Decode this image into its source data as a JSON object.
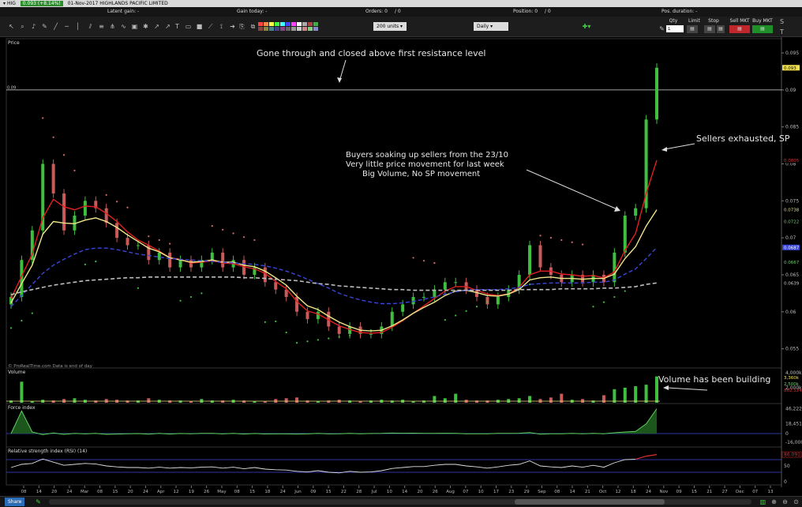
{
  "window": {
    "symbol": "HIG",
    "price_change": "0.093 (+8.14%)",
    "date_name": "01-Nov-2017 HIGHLANDS PACIFIC LIMITED"
  },
  "stats": {
    "latent_gain": "Latent gain: -",
    "gain_today": "Gain today: -",
    "orders": "Orders: 0",
    "orders_tail": "/ 0",
    "position": "Position: 0",
    "position_tail": "/ 0",
    "pos_duration": "Pos. duration: -"
  },
  "toolbar": {
    "units": "200 units",
    "timeframe": "Daily",
    "qty_label": "Qty",
    "qty_value": "1",
    "limit_label": "Limit",
    "stop_label": "Stop",
    "sell_label": "Sell MKT",
    "buy_label": "Buy MKT"
  },
  "panels": {
    "price_label": "Price",
    "volume_label": "Volume",
    "force_label": "Force index",
    "rsi_label": "Relative strength index (RSI) (14)"
  },
  "footer_note": "© ProRealTime.com  Data is end of day",
  "share_label": "Share",
  "colors": {
    "up": "#3fbf3f",
    "down": "#c85a5a",
    "ma_fast": "#e02020",
    "ma_mid": "#f0e68c",
    "ma_blue": "#3a46d8",
    "ma_long": "#bdbdbd",
    "sar_up": "#3fbf3f",
    "sar_down": "#d86a6a",
    "resistance": "#ffffff",
    "background": "#000000"
  },
  "chart_data": {
    "type": "line",
    "x_tick_labels": [
      "08",
      "14",
      "20",
      "24",
      "Mar",
      "08",
      "15",
      "20",
      "24",
      "Apr",
      "12",
      "19",
      "26",
      "May",
      "08",
      "15",
      "18",
      "24",
      "Jun",
      "09",
      "15",
      "22",
      "28",
      "Jul",
      "10",
      "14",
      "20",
      "26",
      "Aug",
      "07",
      "10",
      "17",
      "23",
      "29",
      "Sep",
      "08",
      "14",
      "21",
      "Oct",
      "12",
      "18",
      "24",
      "Nov",
      "09",
      "15",
      "21",
      "27",
      "Dec",
      "07",
      "13"
    ],
    "price_axis": {
      "ylim": [
        0.0525,
        0.0965
      ],
      "ticks": [
        "0.095",
        "0.09",
        "0.085",
        "0.08",
        "0.075",
        "0.07",
        "0.065",
        "0.06",
        "0.055"
      ],
      "markers": [
        {
          "label": "0.093",
          "value": 0.093,
          "color": "#f0e050",
          "text_color": "#000"
        },
        {
          "label": "0.0805",
          "value": 0.0805,
          "color": "#000",
          "text_color": "#e03030"
        },
        {
          "label": "0.0738",
          "value": 0.0738,
          "color": "#000",
          "text_color": "#e0e080"
        },
        {
          "label": "0.0722",
          "value": 0.0722,
          "color": "#000",
          "text_color": "#6fd06f"
        },
        {
          "label": "0.0687",
          "value": 0.0687,
          "color": "#3a46d8",
          "text_color": "#fff"
        },
        {
          "label": "0.0667",
          "value": 0.0667,
          "color": "#000",
          "text_color": "#6fd06f"
        },
        {
          "label": "0.0639",
          "value": 0.0639,
          "color": "#000",
          "text_color": "#ccc"
        }
      ],
      "resistance": {
        "value": 0.09,
        "label": "0.09"
      }
    },
    "close": [
      0.062,
      0.067,
      0.071,
      0.08,
      0.076,
      0.071,
      0.073,
      0.075,
      0.074,
      0.072,
      0.07,
      0.069,
      0.069,
      0.067,
      0.068,
      0.066,
      0.067,
      0.066,
      0.067,
      0.068,
      0.066,
      0.067,
      0.065,
      0.066,
      0.064,
      0.063,
      0.062,
      0.06,
      0.059,
      0.06,
      0.058,
      0.057,
      0.058,
      0.057,
      0.057,
      0.058,
      0.06,
      0.061,
      0.062,
      0.062,
      0.063,
      0.064,
      0.064,
      0.063,
      0.062,
      0.061,
      0.062,
      0.063,
      0.065,
      0.069,
      0.066,
      0.065,
      0.064,
      0.065,
      0.064,
      0.065,
      0.064,
      0.068,
      0.073,
      0.074,
      0.086,
      0.093
    ],
    "series": [
      {
        "name": "Simple moving average 7",
        "values": [
          0.0618,
          0.0648,
          0.0678,
          0.0727,
          0.0752,
          0.0742,
          0.0738,
          0.0743,
          0.0742,
          0.0733,
          0.0722,
          0.0708,
          0.0697,
          0.069,
          0.0682,
          0.0673,
          0.0671,
          0.0666,
          0.0667,
          0.0669,
          0.0666,
          0.0665,
          0.0661,
          0.0658,
          0.0652,
          0.0641,
          0.0631,
          0.0614,
          0.0601,
          0.0597,
          0.0589,
          0.0581,
          0.0576,
          0.0572,
          0.0571,
          0.0572,
          0.0579,
          0.0588,
          0.0598,
          0.0608,
          0.0618,
          0.0628,
          0.0634,
          0.0634,
          0.0629,
          0.0624,
          0.0622,
          0.0624,
          0.0633,
          0.065,
          0.0655,
          0.0655,
          0.0651,
          0.065,
          0.0648,
          0.0649,
          0.0646,
          0.0654,
          0.0683,
          0.0706,
          0.076,
          0.0805
        ]
      },
      {
        "name": "Simple moving average 20",
        "values": [
          0.0612,
          0.0638,
          0.0663,
          0.0705,
          0.0722,
          0.072,
          0.0719,
          0.0724,
          0.0727,
          0.0722,
          0.0714,
          0.0704,
          0.0695,
          0.0686,
          0.0681,
          0.0673,
          0.067,
          0.0667,
          0.0668,
          0.067,
          0.0667,
          0.0667,
          0.0663,
          0.0661,
          0.0655,
          0.0646,
          0.0636,
          0.0621,
          0.0608,
          0.0603,
          0.0594,
          0.0586,
          0.058,
          0.0575,
          0.0574,
          0.0575,
          0.0581,
          0.0589,
          0.0598,
          0.0606,
          0.0613,
          0.0622,
          0.0628,
          0.0629,
          0.0626,
          0.0622,
          0.0621,
          0.0624,
          0.063,
          0.0643,
          0.0646,
          0.0647,
          0.0645,
          0.0645,
          0.0644,
          0.0645,
          0.0645,
          0.0651,
          0.0672,
          0.0688,
          0.0716,
          0.0738
        ]
      },
      {
        "name": "Moving average 50",
        "values": [
          0.0607,
          0.0622,
          0.0637,
          0.0652,
          0.0663,
          0.0671,
          0.0678,
          0.0684,
          0.0686,
          0.0686,
          0.0684,
          0.0681,
          0.0678,
          0.0676,
          0.0674,
          0.0672,
          0.0671,
          0.067,
          0.0669,
          0.0668,
          0.0667,
          0.0666,
          0.0665,
          0.0664,
          0.0662,
          0.0659,
          0.0655,
          0.065,
          0.0644,
          0.0638,
          0.0632,
          0.0625,
          0.062,
          0.0616,
          0.0613,
          0.0611,
          0.0611,
          0.0612,
          0.0614,
          0.0617,
          0.062,
          0.0624,
          0.0627,
          0.0629,
          0.063,
          0.063,
          0.063,
          0.0631,
          0.0633,
          0.0637,
          0.0638,
          0.0639,
          0.0639,
          0.0639,
          0.0639,
          0.064,
          0.064,
          0.0643,
          0.0651,
          0.0658,
          0.0672,
          0.0687
        ]
      },
      {
        "name": "Moving average 200",
        "values": [
          0.0623,
          0.0627,
          0.063,
          0.0633,
          0.0636,
          0.0638,
          0.064,
          0.0642,
          0.0643,
          0.0644,
          0.0645,
          0.0646,
          0.0646,
          0.0647,
          0.0647,
          0.0647,
          0.0647,
          0.0647,
          0.0647,
          0.0647,
          0.0647,
          0.0647,
          0.0646,
          0.0646,
          0.0645,
          0.0644,
          0.0643,
          0.0642,
          0.064,
          0.0638,
          0.0637,
          0.0635,
          0.0634,
          0.0633,
          0.0632,
          0.0631,
          0.063,
          0.063,
          0.0629,
          0.0629,
          0.0629,
          0.0629,
          0.0629,
          0.0629,
          0.0629,
          0.0629,
          0.0629,
          0.0629,
          0.063,
          0.063,
          0.063,
          0.063,
          0.0631,
          0.0631,
          0.0631,
          0.0631,
          0.0632,
          0.0632,
          0.0633,
          0.0634,
          0.0637,
          0.0639
        ]
      }
    ],
    "sar_down": [
      [
        3,
        0.0862
      ],
      [
        4,
        0.0836
      ],
      [
        5,
        0.0812
      ],
      [
        6,
        0.0791
      ],
      [
        9,
        0.0758
      ],
      [
        10,
        0.0749
      ],
      [
        11,
        0.0741
      ],
      [
        13,
        0.0702
      ],
      [
        14,
        0.0697
      ],
      [
        15,
        0.0692
      ],
      [
        19,
        0.0716
      ],
      [
        20,
        0.0711
      ],
      [
        21,
        0.0706
      ],
      [
        22,
        0.0701
      ],
      [
        23,
        0.0697
      ],
      [
        38,
        0.0673
      ],
      [
        39,
        0.0669
      ],
      [
        40,
        0.0666
      ],
      [
        50,
        0.0703
      ],
      [
        51,
        0.07
      ],
      [
        52,
        0.0697
      ],
      [
        53,
        0.0694
      ],
      [
        54,
        0.0691
      ]
    ],
    "sar_up": [
      [
        0,
        0.0578
      ],
      [
        1,
        0.0588
      ],
      [
        2,
        0.0598
      ],
      [
        7,
        0.0664
      ],
      [
        8,
        0.0668
      ],
      [
        12,
        0.0632
      ],
      [
        16,
        0.0615
      ],
      [
        17,
        0.062
      ],
      [
        18,
        0.0625
      ],
      [
        24,
        0.0586
      ],
      [
        25,
        0.0587
      ],
      [
        26,
        0.0572
      ],
      [
        27,
        0.0558
      ],
      [
        28,
        0.056
      ],
      [
        29,
        0.0562
      ],
      [
        30,
        0.0564
      ],
      [
        31,
        0.0566
      ],
      [
        32,
        0.0568
      ],
      [
        33,
        0.0571
      ],
      [
        34,
        0.0575
      ],
      [
        35,
        0.0579
      ],
      [
        36,
        0.0584
      ],
      [
        37,
        0.0588
      ],
      [
        41,
        0.0589
      ],
      [
        42,
        0.0595
      ],
      [
        43,
        0.0601
      ],
      [
        44,
        0.0607
      ],
      [
        45,
        0.0613
      ],
      [
        46,
        0.0619
      ],
      [
        47,
        0.0625
      ],
      [
        48,
        0.0631
      ],
      [
        49,
        0.0637
      ],
      [
        55,
        0.0607
      ],
      [
        56,
        0.0613
      ],
      [
        57,
        0.062
      ],
      [
        58,
        0.0628
      ]
    ],
    "volume": {
      "ticks": [
        "4,000k",
        "2,000k"
      ],
      "markers": [
        "3,360k",
        "2,500k",
        "862,124"
      ],
      "ylim": [
        0,
        4200
      ],
      "values": [
        300,
        2800,
        200,
        400,
        300,
        500,
        600,
        400,
        300,
        500,
        400,
        300,
        300,
        600,
        400,
        300,
        300,
        200,
        500,
        300,
        300,
        400,
        300,
        200,
        200,
        500,
        600,
        700,
        300,
        200,
        300,
        400,
        300,
        200,
        300,
        400,
        300,
        400,
        200,
        300,
        900,
        600,
        1200,
        400,
        300,
        300,
        400,
        500,
        600,
        900,
        500,
        700,
        1200,
        400,
        500,
        300,
        1000,
        1800,
        2000,
        2200,
        2400,
        3500
      ]
    },
    "force_index": {
      "ticks": [
        "46,222",
        "18,451",
        "0",
        "-16,000"
      ],
      "ylim": [
        -22000,
        50000
      ],
      "values": [
        0,
        42000,
        3000,
        -2000,
        1000,
        -1500,
        500,
        -500,
        300,
        -1500,
        -800,
        -300,
        0,
        -1000,
        400,
        -800,
        200,
        -300,
        300,
        400,
        -600,
        300,
        -800,
        200,
        -700,
        -600,
        -500,
        -900,
        -600,
        300,
        -500,
        -400,
        400,
        -200,
        200,
        400,
        900,
        600,
        800,
        300,
        500,
        600,
        300,
        -200,
        -300,
        -400,
        300,
        400,
        600,
        2000,
        -1000,
        -400,
        -300,
        300,
        -300,
        400,
        -200,
        1500,
        3000,
        4000,
        18000,
        46222
      ]
    },
    "rsi": {
      "ticks": [
        "86.091",
        "50",
        "0"
      ],
      "ylim": [
        0,
        100
      ],
      "levels": [
        70,
        30
      ],
      "values": [
        45,
        55,
        58,
        72,
        62,
        52,
        55,
        58,
        56,
        50,
        47,
        45,
        45,
        43,
        46,
        43,
        45,
        44,
        46,
        47,
        43,
        46,
        41,
        45,
        40,
        38,
        37,
        33,
        31,
        35,
        30,
        28,
        33,
        30,
        31,
        35,
        42,
        45,
        48,
        48,
        52,
        55,
        55,
        50,
        47,
        43,
        47,
        52,
        55,
        66,
        50,
        47,
        45,
        50,
        46,
        52,
        46,
        60,
        70,
        71,
        81,
        86.091
      ]
    }
  },
  "annotations": {
    "resistance": "Gone through and closed above first resistance level",
    "buyers": [
      "Buyers soaking up sellers from the 23/10",
      "Very little price movement for last week",
      "Big Volume, No SP movement"
    ],
    "sellers": "Sellers exhausted, SP",
    "volume": "Volume has been building"
  }
}
